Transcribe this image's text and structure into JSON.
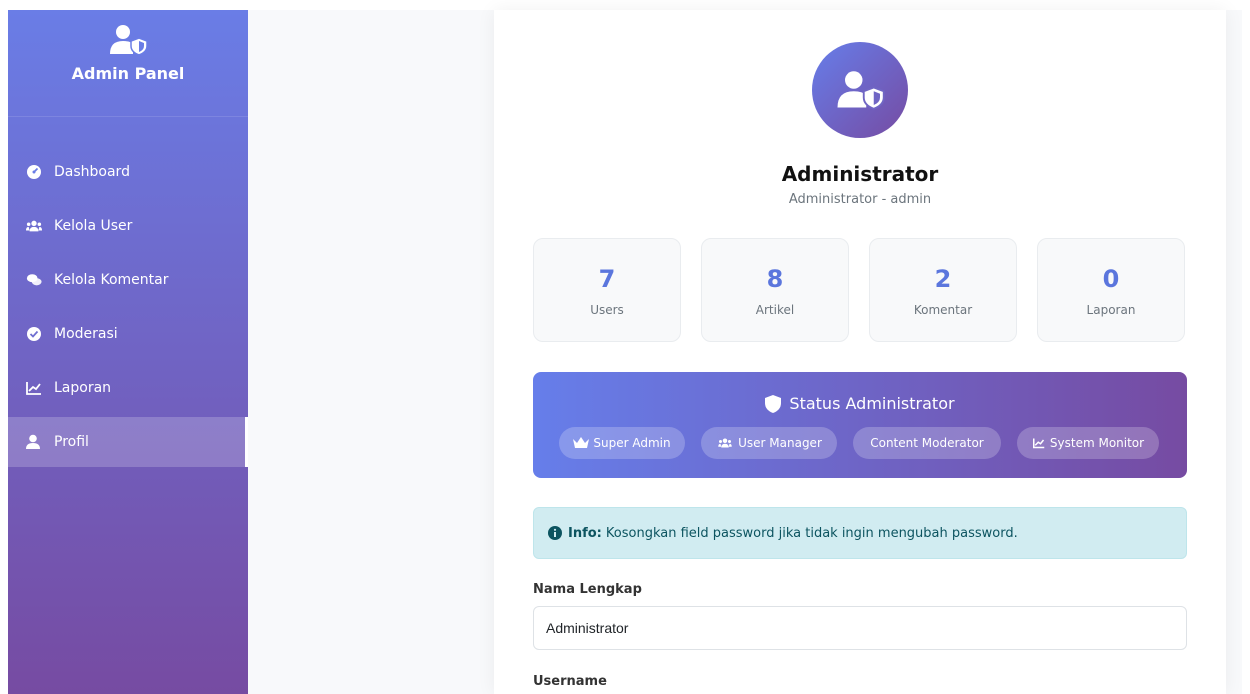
{
  "sidebar": {
    "brand": "Admin Panel",
    "items": [
      {
        "label": "Dashboard",
        "icon": "dashboard-icon"
      },
      {
        "label": "Kelola User",
        "icon": "users-icon"
      },
      {
        "label": "Kelola Komentar",
        "icon": "comments-icon"
      },
      {
        "label": "Moderasi",
        "icon": "check-circle-icon"
      },
      {
        "label": "Laporan",
        "icon": "chart-line-icon"
      },
      {
        "label": "Profil",
        "icon": "user-icon",
        "active": true
      }
    ]
  },
  "profile": {
    "name": "Administrator",
    "role": "Administrator - admin"
  },
  "stats": [
    {
      "value": "7",
      "label": "Users"
    },
    {
      "value": "8",
      "label": "Artikel"
    },
    {
      "value": "2",
      "label": "Komentar"
    },
    {
      "value": "0",
      "label": "Laporan"
    }
  ],
  "status": {
    "title": "Status Administrator",
    "badges": [
      {
        "label": "Super Admin",
        "icon": "crown-icon"
      },
      {
        "label": "User Manager",
        "icon": "users-icon"
      },
      {
        "label": "Content Moderator",
        "icon": ""
      },
      {
        "label": "System Monitor",
        "icon": "chart-line-icon"
      }
    ]
  },
  "info": {
    "label": "Info:",
    "text": "Kosongkan field password jika tidak ingin mengubah password."
  },
  "form": {
    "fullname_label": "Nama Lengkap",
    "fullname_value": "Administrator",
    "username_label": "Username"
  },
  "colors": {
    "gradient_start": "#667eea",
    "gradient_end": "#764ba2",
    "stat_number": "#5b76dd",
    "info_bg": "#d1ecf1",
    "info_text": "#0c5460"
  }
}
